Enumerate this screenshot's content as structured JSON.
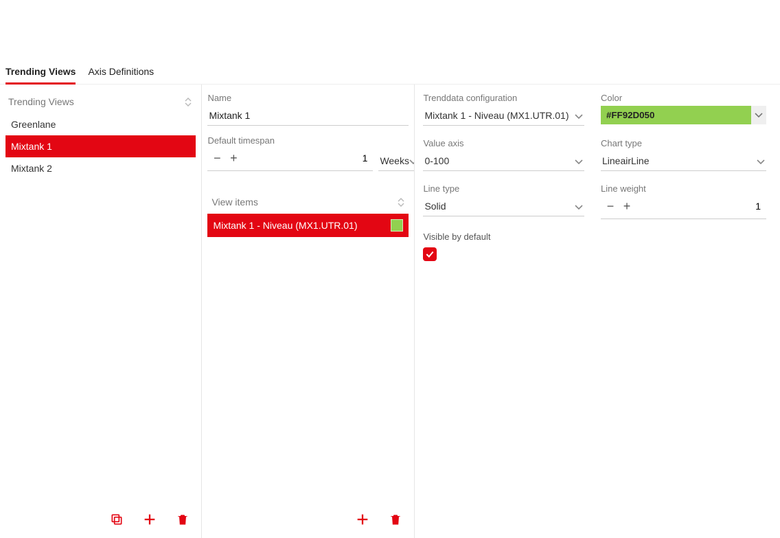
{
  "tabs": [
    {
      "label": "Trending Views",
      "active": true
    },
    {
      "label": "Axis Definitions",
      "active": false
    }
  ],
  "sidebar": {
    "header": "Trending Views",
    "items": [
      {
        "label": "Greenlane",
        "selected": false
      },
      {
        "label": "Mixtank 1",
        "selected": true
      },
      {
        "label": "Mixtank 2",
        "selected": false
      }
    ]
  },
  "form": {
    "name_label": "Name",
    "name_value": "Mixtank 1",
    "timespan_label": "Default timespan",
    "timespan_value": "1",
    "timespan_unit": "Weeks",
    "viewitems_header": "View items",
    "viewitems": [
      {
        "label": "Mixtank 1 - Niveau (MX1.UTR.01)",
        "color": "#92D050",
        "selected": true
      }
    ]
  },
  "details": {
    "trenddata_label": "Trenddata configuration",
    "trenddata_value": "Mixtank 1 - Niveau (MX1.UTR.01)",
    "color_label": "Color",
    "color_value": "#FF92D050",
    "color_swatch": "#92D050",
    "valueaxis_label": "Value axis",
    "valueaxis_value": "0-100",
    "charttype_label": "Chart type",
    "charttype_value": "LineairLine",
    "linetype_label": "Line type",
    "linetype_value": "Solid",
    "lineweight_label": "Line weight",
    "lineweight_value": "1",
    "visible_label": "Visible by default",
    "visible_checked": true
  }
}
